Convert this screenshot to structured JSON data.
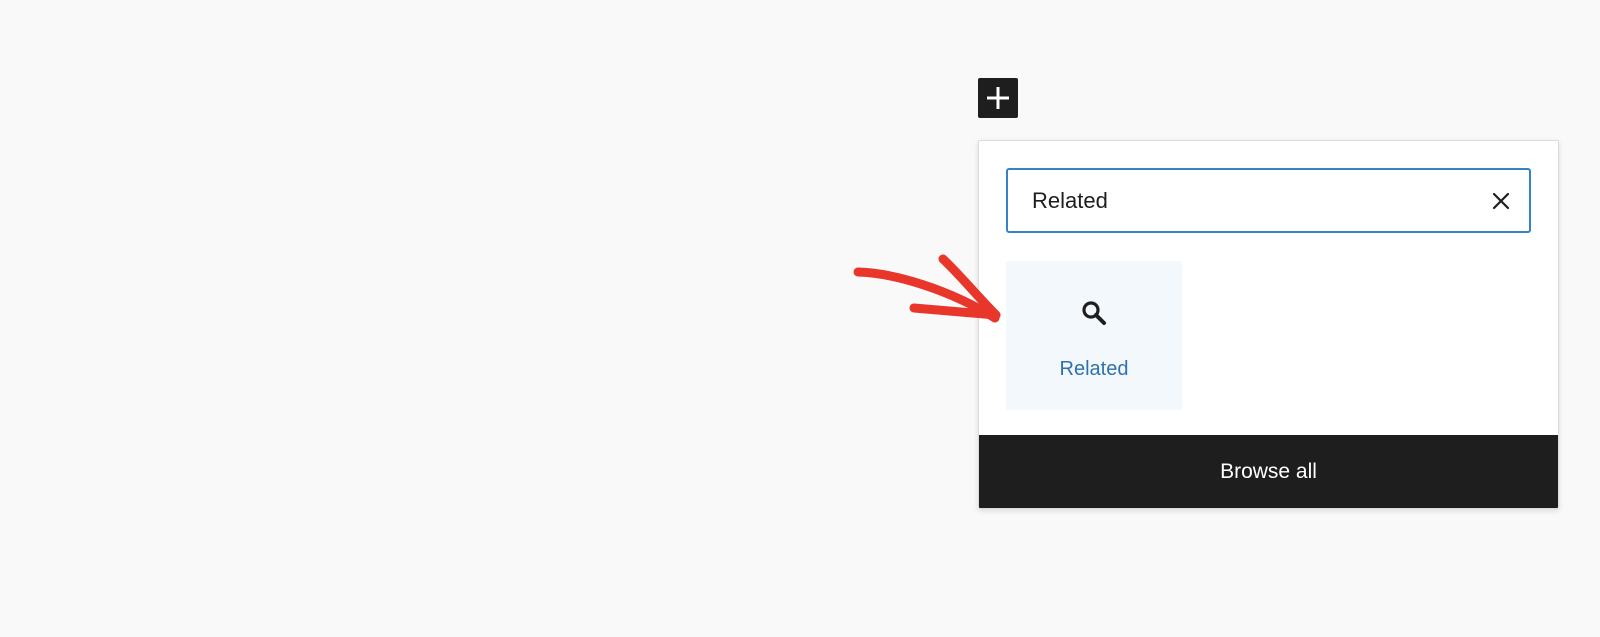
{
  "inserter": {
    "toggle_icon": "plus-icon",
    "search": {
      "value": "Related",
      "clear_icon": "close-icon"
    },
    "results": [
      {
        "label": "Related",
        "icon": "search-icon"
      }
    ],
    "browse_all_label": "Browse all"
  },
  "annotation": {
    "arrow_color": "#e8362a"
  },
  "colors": {
    "accent": "#3582c4",
    "block_label": "#2d72ad",
    "dark": "#1e1e1e"
  }
}
